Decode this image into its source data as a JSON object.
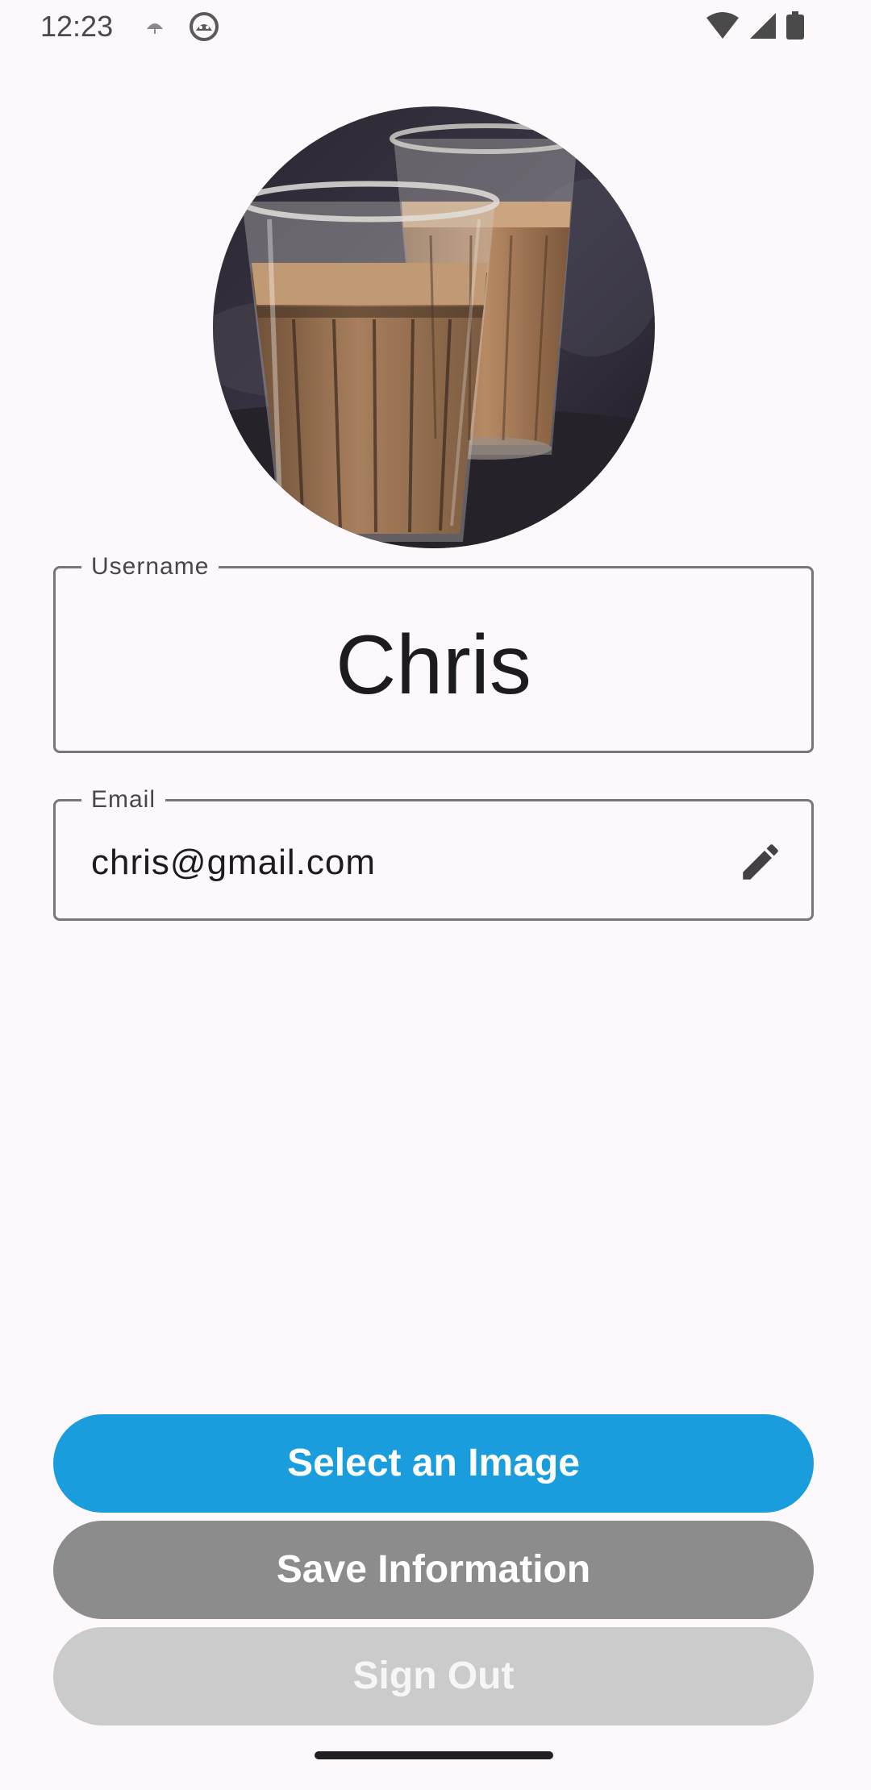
{
  "status_bar": {
    "time": "12:23",
    "left_icons": [
      "umbrella-icon",
      "android-face-icon"
    ],
    "right_icons": [
      "wifi-icon",
      "cell-signal-icon",
      "battery-icon"
    ]
  },
  "profile": {
    "avatar": "profile-photo-chai-glasses",
    "username_label": "Username",
    "username_value": "Chris",
    "email_label": "Email",
    "email_value": "chris@gmail.com",
    "email_action_icon": "pencil-edit-icon"
  },
  "actions": {
    "select_image_label": "Select an Image",
    "save_label": "Save Information",
    "sign_out_label": "Sign Out"
  },
  "colors": {
    "primary": "#199ddd",
    "save_button": "#8c8c8c",
    "sign_out_button": "#cbcbcb",
    "background": "#fdf8fc"
  }
}
